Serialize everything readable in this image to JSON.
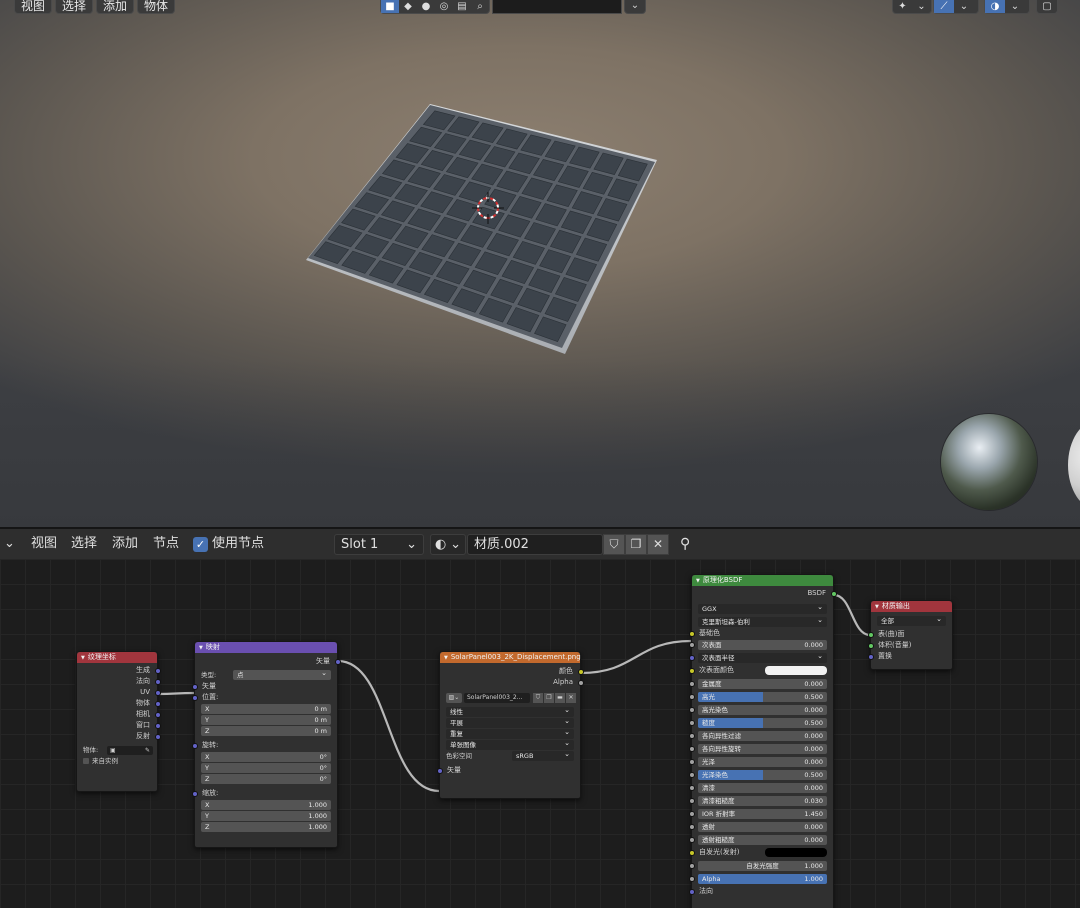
{
  "viewport": {
    "menu": [
      "视图",
      "选择",
      "添加",
      "物体"
    ]
  },
  "header": {
    "menu": [
      "视图",
      "选择",
      "添加",
      "节点"
    ],
    "use_nodes_label": "使用节点",
    "slot_label": "Slot 1",
    "material_name": "材质.002"
  },
  "nodes": {
    "texcoord": {
      "title": "纹理坐标",
      "outputs": [
        "生成",
        "法向",
        "UV",
        "物体",
        "相机",
        "窗口",
        "反射"
      ],
      "object_label": "物体:",
      "from_instancer": "来自实例"
    },
    "mapping": {
      "title": "映射",
      "output": "矢量",
      "type_label": "类型:",
      "type_value": "点",
      "vector_label": "矢量",
      "location_label": "位置:",
      "location": [
        {
          "axis": "X",
          "value": "0 m"
        },
        {
          "axis": "Y",
          "value": "0 m"
        },
        {
          "axis": "Z",
          "value": "0 m"
        }
      ],
      "rotation_label": "旋转:",
      "rotation": [
        {
          "axis": "X",
          "value": "0°"
        },
        {
          "axis": "Y",
          "value": "0°"
        },
        {
          "axis": "Z",
          "value": "0°"
        }
      ],
      "scale_label": "缩放:",
      "scale": [
        {
          "axis": "X",
          "value": "1.000"
        },
        {
          "axis": "Y",
          "value": "1.000"
        },
        {
          "axis": "Z",
          "value": "1.000"
        }
      ]
    },
    "image": {
      "title": "SolarPanel003_2K_Displacement.png",
      "outputs": [
        "颜色",
        "Alpha"
      ],
      "image_name": "SolarPanel003_2...",
      "interpolation": "线性",
      "projection": "平展",
      "extension": "重复",
      "source": "单张图像",
      "colorspace_label": "色彩空间",
      "colorspace_value": "sRGB",
      "vector_input": "矢量"
    },
    "bsdf": {
      "title": "原理化BSDF",
      "output": "BSDF",
      "distribution": "GGX",
      "subsurface_method": "克里斯坦森-伯利",
      "base_color_label": "基础色",
      "subsurface_radius_label": "次表面半径",
      "subsurface_color_label": "次表面颜色",
      "emission_label": "自发光(发射)",
      "normal_label": "法向",
      "params": [
        {
          "label": "次表面",
          "value": "0.000",
          "fill": 0
        },
        {
          "label": "金属度",
          "value": "0.000",
          "fill": 0
        },
        {
          "label": "高光",
          "value": "0.500",
          "fill": 0.5
        },
        {
          "label": "高光染色",
          "value": "0.000",
          "fill": 0
        },
        {
          "label": "糙度",
          "value": "0.500",
          "fill": 0.5
        },
        {
          "label": "各向异性过滤",
          "value": "0.000",
          "fill": 0
        },
        {
          "label": "各向异性旋转",
          "value": "0.000",
          "fill": 0
        },
        {
          "label": "光泽",
          "value": "0.000",
          "fill": 0
        },
        {
          "label": "光泽染色",
          "value": "0.500",
          "fill": 0.5
        },
        {
          "label": "清漆",
          "value": "0.000",
          "fill": 0
        },
        {
          "label": "清漆粗糙度",
          "value": "0.030",
          "fill": 0
        },
        {
          "label": "IOR 折射率",
          "value": "1.450",
          "fill": 0
        },
        {
          "label": "透射",
          "value": "0.000",
          "fill": 0
        },
        {
          "label": "透射粗糙度",
          "value": "0.000",
          "fill": 0
        }
      ],
      "emission_strength_label": "自发光强度",
      "emission_strength_value": "1.000",
      "alpha_label": "Alpha",
      "alpha_value": "1.000"
    },
    "output": {
      "title": "材质输出",
      "target": "全部",
      "inputs": [
        "表(曲)面",
        "体积(音量)",
        "置换"
      ]
    }
  },
  "colors": {
    "accent": "#4772b3",
    "texcoord_header": "#a1353d",
    "mapping_header": "#6a4fb0",
    "image_header": "#c2692d",
    "bsdf_header": "#3e8a3e",
    "output_header": "#a1353d"
  }
}
